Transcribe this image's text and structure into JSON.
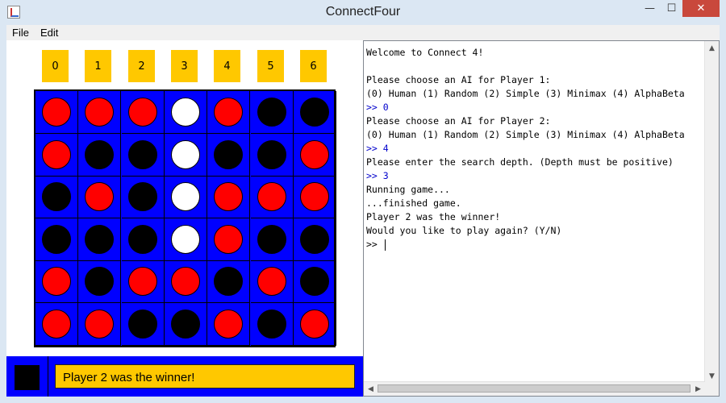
{
  "window": {
    "title": "ConnectFour",
    "icon": "java-app-icon",
    "minimize_glyph": "—",
    "maximize_glyph": "☐",
    "close_glyph": "✕"
  },
  "menubar": {
    "items": [
      "File",
      "Edit"
    ]
  },
  "board": {
    "columns": [
      "0",
      "1",
      "2",
      "3",
      "4",
      "5",
      "6"
    ],
    "cells": [
      [
        "red",
        "red",
        "red",
        "white",
        "red",
        "black",
        "black"
      ],
      [
        "red",
        "black",
        "black",
        "white",
        "black",
        "black",
        "red"
      ],
      [
        "black",
        "red",
        "black",
        "white",
        "red",
        "red",
        "red"
      ],
      [
        "black",
        "black",
        "black",
        "white",
        "red",
        "black",
        "black"
      ],
      [
        "red",
        "black",
        "red",
        "red",
        "black",
        "red",
        "black"
      ],
      [
        "red",
        "red",
        "black",
        "black",
        "red",
        "black",
        "red"
      ]
    ],
    "colors": {
      "board": "#0000ff",
      "red": "#ff0000",
      "black": "#000000",
      "white": "#ffffff",
      "button": "#ffc800"
    }
  },
  "status": {
    "turn_color": "black",
    "message": "Player 2 was the winner!"
  },
  "console": {
    "lines": [
      {
        "type": "out",
        "text": "Welcome to Connect 4!"
      },
      {
        "type": "out",
        "text": ""
      },
      {
        "type": "out",
        "text": "Please choose an AI for Player 1:"
      },
      {
        "type": "out",
        "text": "(0) Human (1) Random (2) Simple (3) Minimax (4) AlphaBeta"
      },
      {
        "type": "in",
        "text": ">> 0"
      },
      {
        "type": "out",
        "text": "Please choose an AI for Player 2:"
      },
      {
        "type": "out",
        "text": "(0) Human (1) Random (2) Simple (3) Minimax (4) AlphaBeta"
      },
      {
        "type": "in",
        "text": ">> 4"
      },
      {
        "type": "out",
        "text": "Please enter the search depth. (Depth must be positive)"
      },
      {
        "type": "in",
        "text": ">> 3"
      },
      {
        "type": "out",
        "text": "Running game..."
      },
      {
        "type": "out",
        "text": "...finished game."
      },
      {
        "type": "out",
        "text": "Player 2 was the winner!"
      },
      {
        "type": "out",
        "text": "Would you like to play again? (Y/N)"
      }
    ],
    "prompt": ">> "
  }
}
